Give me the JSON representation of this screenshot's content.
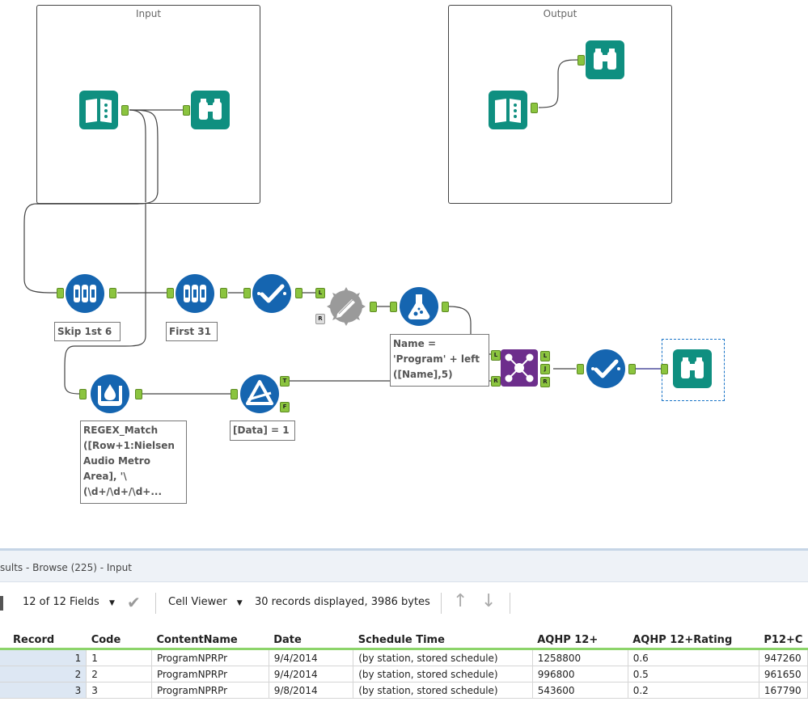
{
  "containers": {
    "input_title": "Input",
    "output_title": "Output"
  },
  "tools": [
    {
      "id": "input-data-1",
      "kind": "input-book-icon"
    },
    {
      "id": "browse-1",
      "kind": "binoculars-icon"
    },
    {
      "id": "input-data-2",
      "kind": "input-book-icon"
    },
    {
      "id": "browse-2",
      "kind": "binoculars-icon"
    },
    {
      "id": "sample-skip",
      "kind": "sample-tubes-icon"
    },
    {
      "id": "sample-first",
      "kind": "sample-tubes-icon"
    },
    {
      "id": "select-1",
      "kind": "check-icon"
    },
    {
      "id": "dynamic-rename",
      "kind": "gear-pencil-icon"
    },
    {
      "id": "formula",
      "kind": "flask-icon"
    },
    {
      "id": "regex",
      "kind": "regex-drop-icon"
    },
    {
      "id": "filter",
      "kind": "filter-triangle-icon"
    },
    {
      "id": "join",
      "kind": "join-icon"
    },
    {
      "id": "select-2",
      "kind": "check-icon"
    },
    {
      "id": "browse-3",
      "kind": "binoculars-icon"
    }
  ],
  "annotations": {
    "skip": "Skip 1st 6",
    "first": "First 31",
    "formula": "Name = 'Program' + left ([Name],5)",
    "regex": "REGEX_Match ([Row+1:Nielsen Audio Metro Area], '\\(\\d+/\\d+/\\d+...",
    "filter": "[Data] = 1"
  },
  "anchor_labels": {
    "left": "L",
    "right": "R",
    "join": "J",
    "true": "T",
    "false": "F"
  },
  "results": {
    "title": "sults - Browse (225) - Input",
    "fields_label": "12 of 12 Fields",
    "cell_viewer": "Cell Viewer",
    "records_info": "30 records displayed, 3986 bytes",
    "columns": [
      "Record",
      "Code",
      "ContentName",
      "Date",
      "Schedule Time",
      "AQHP 12+",
      "AQHP 12+Rating",
      "P12+C"
    ],
    "rows": [
      [
        "1",
        "1",
        "ProgramNPRPr",
        "9/4/2014",
        "(by station, stored schedule)",
        "1258800",
        "0.6",
        "947260"
      ],
      [
        "2",
        "2",
        "ProgramNPRPr",
        "9/4/2014",
        "(by station, stored schedule)",
        "996800",
        "0.5",
        "961650"
      ],
      [
        "3",
        "3",
        "ProgramNPRPr",
        "9/8/2014",
        "(by station, stored schedule)",
        "543600",
        "0.2",
        "167790"
      ]
    ]
  },
  "colors": {
    "green_tool": "#0f8f80",
    "blue_tool": "#1565b0",
    "purple_join": "#6d2e8c",
    "gray_tool": "#9a9a9a",
    "anchor_green": "#8bc43f"
  }
}
